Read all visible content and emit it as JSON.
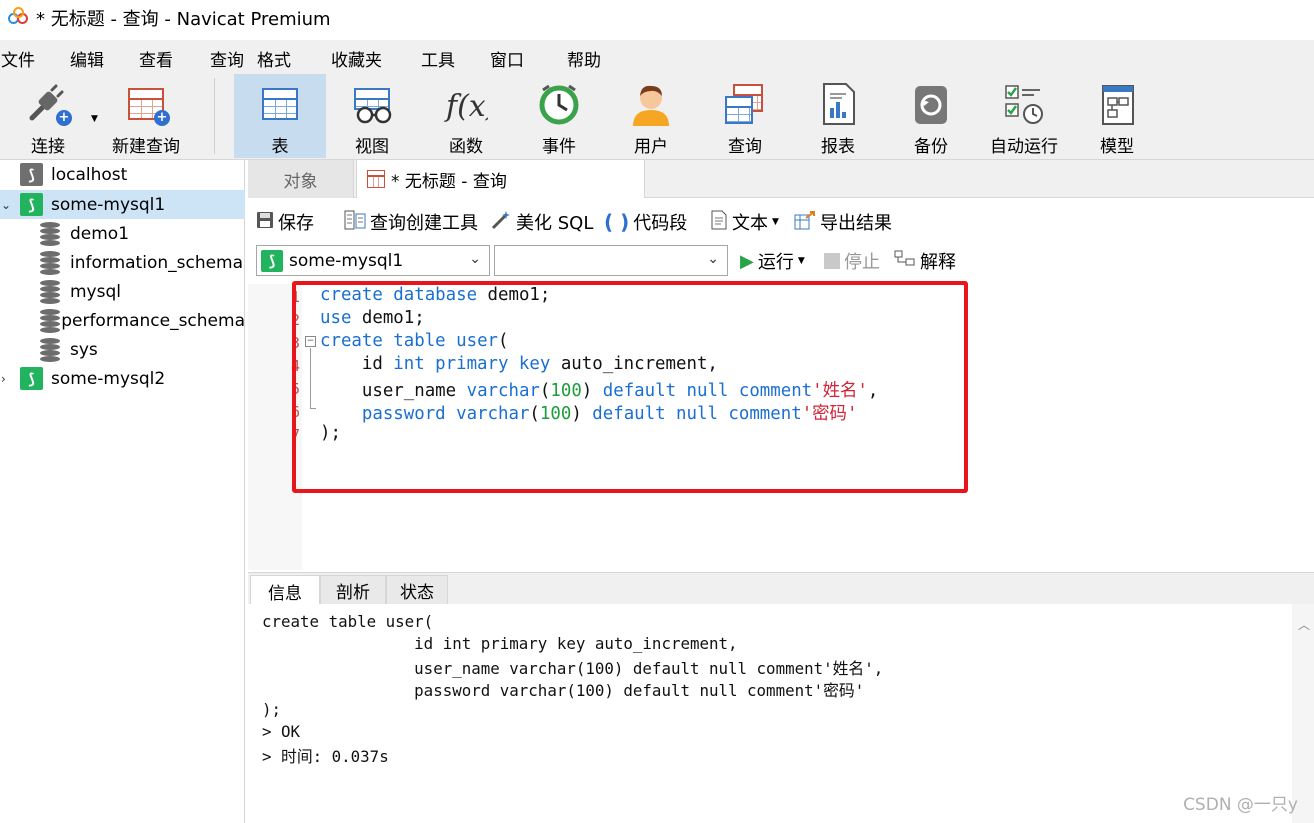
{
  "window": {
    "title": "* 无标题 - 查询 - Navicat Premium"
  },
  "menu": [
    "文件",
    "编辑",
    "查看",
    "查询",
    "格式",
    "收藏夹",
    "工具",
    "窗口",
    "帮助"
  ],
  "toolbar": {
    "connect": "连接",
    "new_query": "新建查询",
    "table": "表",
    "view": "视图",
    "function": "函数",
    "event": "事件",
    "user": "用户",
    "query": "查询",
    "report": "报表",
    "backup": "备份",
    "automation": "自动运行",
    "model": "模型"
  },
  "tree": {
    "items": [
      {
        "label": "localhost",
        "type": "connection"
      },
      {
        "label": "some-mysql1",
        "type": "connection"
      },
      {
        "label": "demo1",
        "type": "database"
      },
      {
        "label": "information_schema",
        "type": "database"
      },
      {
        "label": "mysql",
        "type": "database"
      },
      {
        "label": "performance_schema",
        "type": "database"
      },
      {
        "label": "sys",
        "type": "database"
      },
      {
        "label": "some-mysql2",
        "type": "connection"
      }
    ]
  },
  "tabs": {
    "objects": "对象",
    "query": "* 无标题 - 查询"
  },
  "query_toolbar": {
    "save": "保存",
    "query_builder": "查询创建工具",
    "beautify": "美化 SQL",
    "snippet": "代码段",
    "text": "文本",
    "export": "导出结果"
  },
  "connection_bar": {
    "connection": "some-mysql1",
    "database": "",
    "run": "运行",
    "stop": "停止",
    "explain": "解释"
  },
  "editor": {
    "line_numbers": [
      "1",
      "2",
      "3",
      "4",
      "5",
      "6",
      "7"
    ]
  },
  "result_tabs": {
    "info": "信息",
    "profile": "剖析",
    "status": "状态"
  },
  "result_lines": [
    "create table user(",
    "                id int primary key auto_increment,",
    "                user_name varchar(100) default null comment'姓名',",
    "                password varchar(100) default null comment'密码'",
    ");",
    "> OK",
    "> 时间: 0.037s"
  ],
  "watermark": "CSDN @一只y",
  "colors": {
    "keyword": "#1a6fd1",
    "number": "#1e9e3a",
    "string": "#d0253a",
    "highlight": "#e8161b",
    "selected": "#cde4f7"
  }
}
